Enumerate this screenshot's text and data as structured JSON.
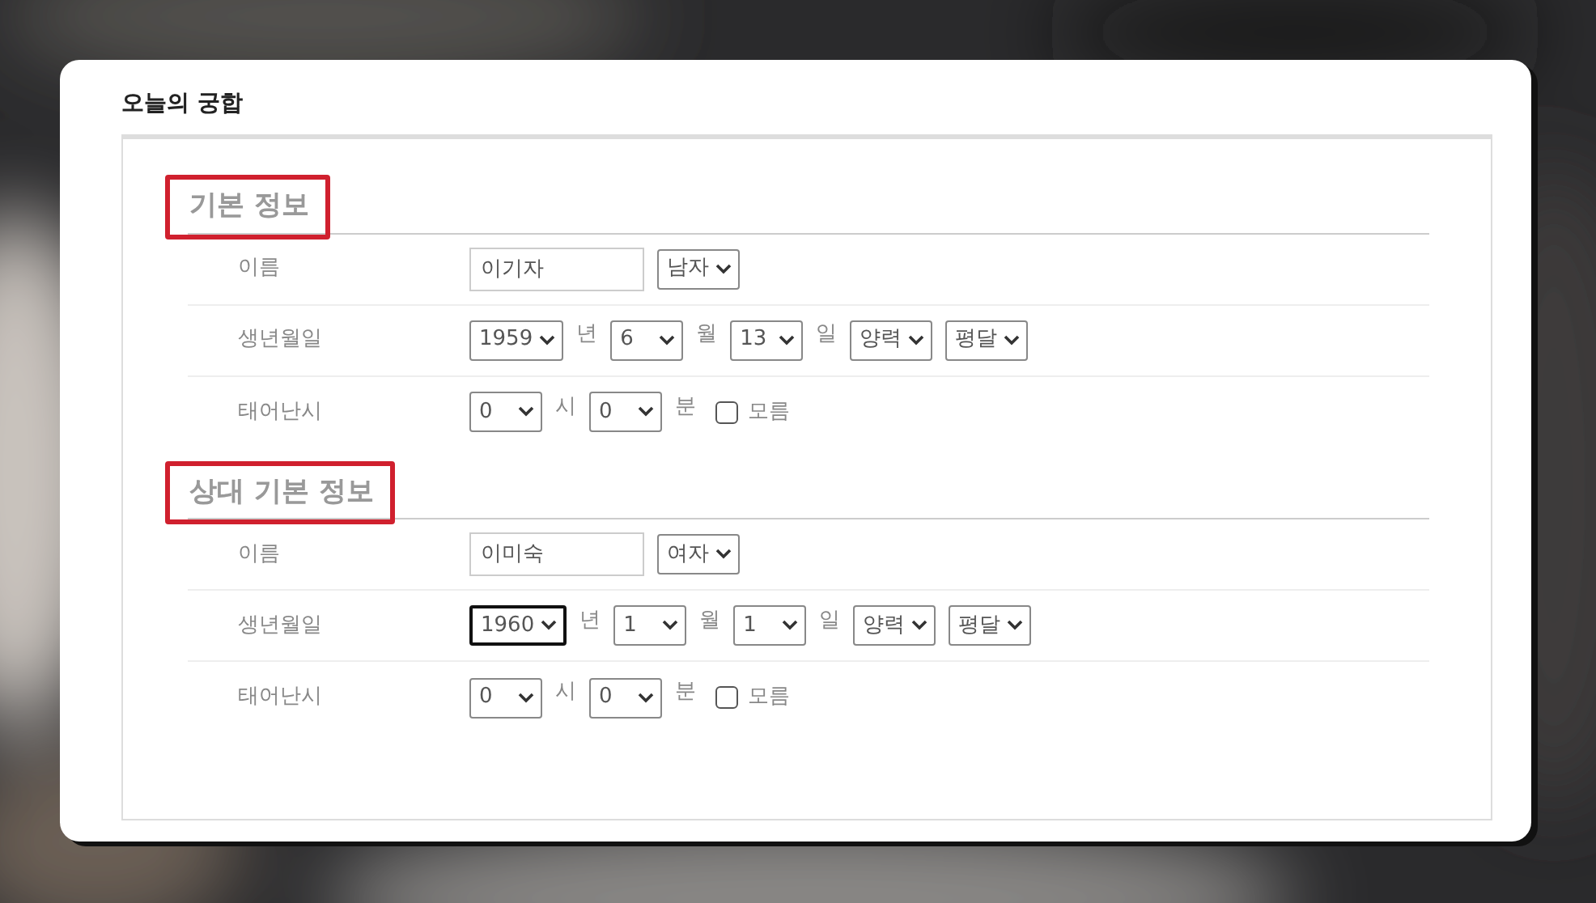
{
  "title": "오늘의 궁합",
  "sections": [
    {
      "heading": "기본 정보",
      "highlighted": true,
      "rows": [
        {
          "label": "이름",
          "controls": [
            {
              "kind": "input",
              "value": "이기자"
            },
            {
              "kind": "select",
              "value": "남자",
              "focused": false
            }
          ]
        },
        {
          "label": "생년월일",
          "controls": [
            {
              "kind": "select",
              "value": "1959",
              "focused": false
            },
            {
              "kind": "unit",
              "text": "년"
            },
            {
              "kind": "select",
              "value": "6",
              "focused": false
            },
            {
              "kind": "unit",
              "text": "월"
            },
            {
              "kind": "select",
              "value": "13",
              "focused": false
            },
            {
              "kind": "unit",
              "text": "일"
            },
            {
              "kind": "select",
              "value": "양력",
              "focused": false
            },
            {
              "kind": "select",
              "value": "평달",
              "focused": false
            }
          ]
        },
        {
          "label": "태어난시",
          "controls": [
            {
              "kind": "select",
              "value": "0",
              "focused": false
            },
            {
              "kind": "unit",
              "text": "시"
            },
            {
              "kind": "select",
              "value": "0",
              "focused": false
            },
            {
              "kind": "unit",
              "text": "분"
            },
            {
              "kind": "checkbox",
              "label": "모름",
              "checked": false
            }
          ]
        }
      ]
    },
    {
      "heading": "상대 기본 정보",
      "highlighted": true,
      "rows": [
        {
          "label": "이름",
          "controls": [
            {
              "kind": "input",
              "value": "이미숙"
            },
            {
              "kind": "select",
              "value": "여자",
              "focused": false
            }
          ]
        },
        {
          "label": "생년월일",
          "controls": [
            {
              "kind": "select",
              "value": "1960",
              "focused": true
            },
            {
              "kind": "unit",
              "text": "년"
            },
            {
              "kind": "select",
              "value": "1",
              "focused": false
            },
            {
              "kind": "unit",
              "text": "월"
            },
            {
              "kind": "select",
              "value": "1",
              "focused": false
            },
            {
              "kind": "unit",
              "text": "일"
            },
            {
              "kind": "select",
              "value": "양력",
              "focused": false
            },
            {
              "kind": "select",
              "value": "평달",
              "focused": false
            }
          ]
        },
        {
          "label": "태어난시",
          "controls": [
            {
              "kind": "select",
              "value": "0",
              "focused": false
            },
            {
              "kind": "unit",
              "text": "시"
            },
            {
              "kind": "select",
              "value": "0",
              "focused": false
            },
            {
              "kind": "unit",
              "text": "분"
            },
            {
              "kind": "checkbox",
              "label": "모름",
              "checked": false
            }
          ]
        }
      ]
    }
  ]
}
